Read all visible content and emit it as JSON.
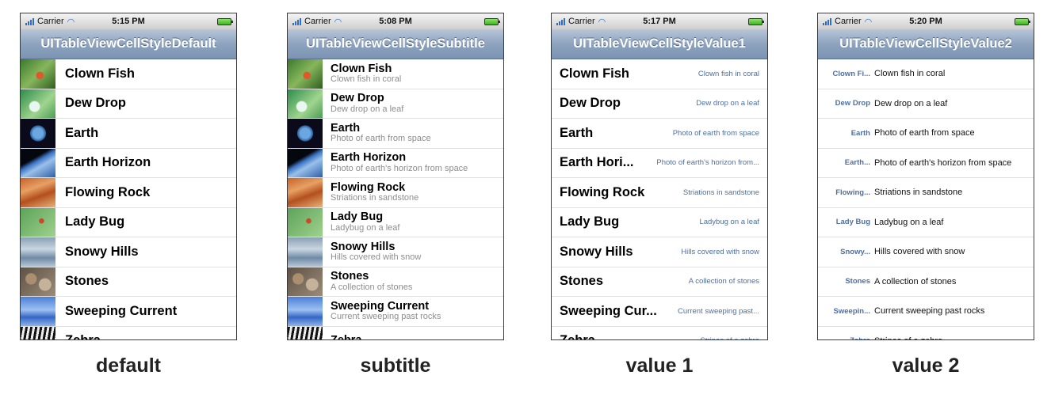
{
  "screens": [
    {
      "carrier": "Carrier",
      "time": "5:15 PM",
      "title": "UITableViewCellStyleDefault",
      "caption": "default"
    },
    {
      "carrier": "Carrier",
      "time": "5:08 PM",
      "title": "UITableViewCellStyleSubtitle",
      "caption": "subtitle"
    },
    {
      "carrier": "Carrier",
      "time": "5:17 PM",
      "title": "UITableViewCellStyleValue1",
      "caption": "value 1"
    },
    {
      "carrier": "Carrier",
      "time": "5:20 PM",
      "title": "UITableViewCellStyleValue2",
      "caption": "value 2"
    }
  ],
  "default_rows": [
    "Clown Fish",
    "Dew Drop",
    "Earth",
    "Earth Horizon",
    "Flowing Rock",
    "Lady Bug",
    "Snowy Hills",
    "Stones",
    "Sweeping Current",
    "Zebra"
  ],
  "subtitle_rows": [
    {
      "title": "Clown Fish",
      "subtitle": "Clown fish in coral"
    },
    {
      "title": "Dew Drop",
      "subtitle": "Dew drop on a leaf"
    },
    {
      "title": "Earth",
      "subtitle": "Photo of earth from space"
    },
    {
      "title": "Earth Horizon",
      "subtitle": "Photo of earth's horizon from space"
    },
    {
      "title": "Flowing Rock",
      "subtitle": "Striations in sandstone"
    },
    {
      "title": "Lady Bug",
      "subtitle": "Ladybug on a leaf"
    },
    {
      "title": "Snowy Hills",
      "subtitle": "Hills covered with snow"
    },
    {
      "title": "Stones",
      "subtitle": "A collection of stones"
    },
    {
      "title": "Sweeping Current",
      "subtitle": "Current sweeping past rocks"
    },
    {
      "title": "Zebra",
      "subtitle": ""
    }
  ],
  "value1_rows": [
    {
      "title": "Clown Fish",
      "detail": "Clown fish in coral"
    },
    {
      "title": "Dew Drop",
      "detail": "Dew drop on a leaf"
    },
    {
      "title": "Earth",
      "detail": "Photo of earth from space"
    },
    {
      "title": "Earth Hori...",
      "detail": "Photo of earth's horizon from..."
    },
    {
      "title": "Flowing Rock",
      "detail": "Striations in sandstone"
    },
    {
      "title": "Lady Bug",
      "detail": "Ladybug on a leaf"
    },
    {
      "title": "Snowy Hills",
      "detail": "Hills covered with snow"
    },
    {
      "title": "Stones",
      "detail": "A collection of stones"
    },
    {
      "title": "Sweeping Cur...",
      "detail": "Current sweeping past..."
    },
    {
      "title": "Zebra",
      "detail": "Stripes of a zebra"
    }
  ],
  "value2_rows": [
    {
      "label": "Clown Fi...",
      "detail": "Clown fish in coral"
    },
    {
      "label": "Dew Drop",
      "detail": "Dew drop on a leaf"
    },
    {
      "label": "Earth",
      "detail": "Photo of earth from space"
    },
    {
      "label": "Earth...",
      "detail": "Photo of earth's horizon from space"
    },
    {
      "label": "Flowing...",
      "detail": "Striations in sandstone"
    },
    {
      "label": "Lady Bug",
      "detail": "Ladybug on a leaf"
    },
    {
      "label": "Snowy...",
      "detail": "Hills covered with snow"
    },
    {
      "label": "Stones",
      "detail": "A collection of stones"
    },
    {
      "label": "Sweepin...",
      "detail": "Current sweeping past rocks"
    },
    {
      "label": "Zebra",
      "detail": "Stripes of a zebra"
    }
  ],
  "thumbnail_icons": [
    "clown-fish-image",
    "dew-drop-image",
    "earth-image",
    "earth-horizon-image",
    "flowing-rock-image",
    "lady-bug-image",
    "snowy-hills-image",
    "stones-image",
    "sweeping-current-image",
    "zebra-image"
  ],
  "colors": {
    "navbar": "#8da3bf",
    "detail_blue": "#4f6f9f",
    "subtitle_gray": "#8e8e8e"
  }
}
